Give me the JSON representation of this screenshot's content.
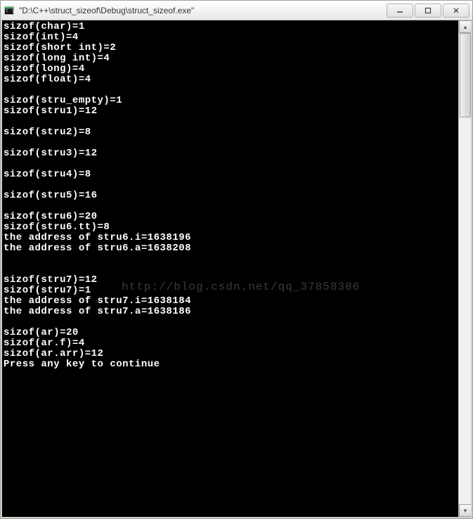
{
  "window": {
    "title": "\"D:\\C++\\struct_sizeof\\Debug\\struct_sizeof.exe\""
  },
  "watermark": "http://blog.csdn.net/qq_37858386",
  "console": {
    "lines": [
      "sizof(char)=1",
      "sizof(int)=4",
      "sizof(short int)=2",
      "sizof(long int)=4",
      "sizof(long)=4",
      "sizof(float)=4",
      "",
      "sizof(stru_empty)=1",
      "sizof(stru1)=12",
      "",
      "sizof(stru2)=8",
      "",
      "sizof(stru3)=12",
      "",
      "sizof(stru4)=8",
      "",
      "sizof(stru5)=16",
      "",
      "sizof(stru6)=20",
      "sizof(stru6.tt)=8",
      "the address of stru6.i=1638196",
      "the address of stru6.a=1638208",
      "",
      "",
      "sizof(stru7)=12",
      "sizof(stru7)=1",
      "the address of stru7.i=1638184",
      "the address of stru7.a=1638186",
      "",
      "sizof(ar)=20",
      "sizof(ar.f)=4",
      "sizof(ar.arr)=12",
      "Press any key to continue"
    ]
  }
}
